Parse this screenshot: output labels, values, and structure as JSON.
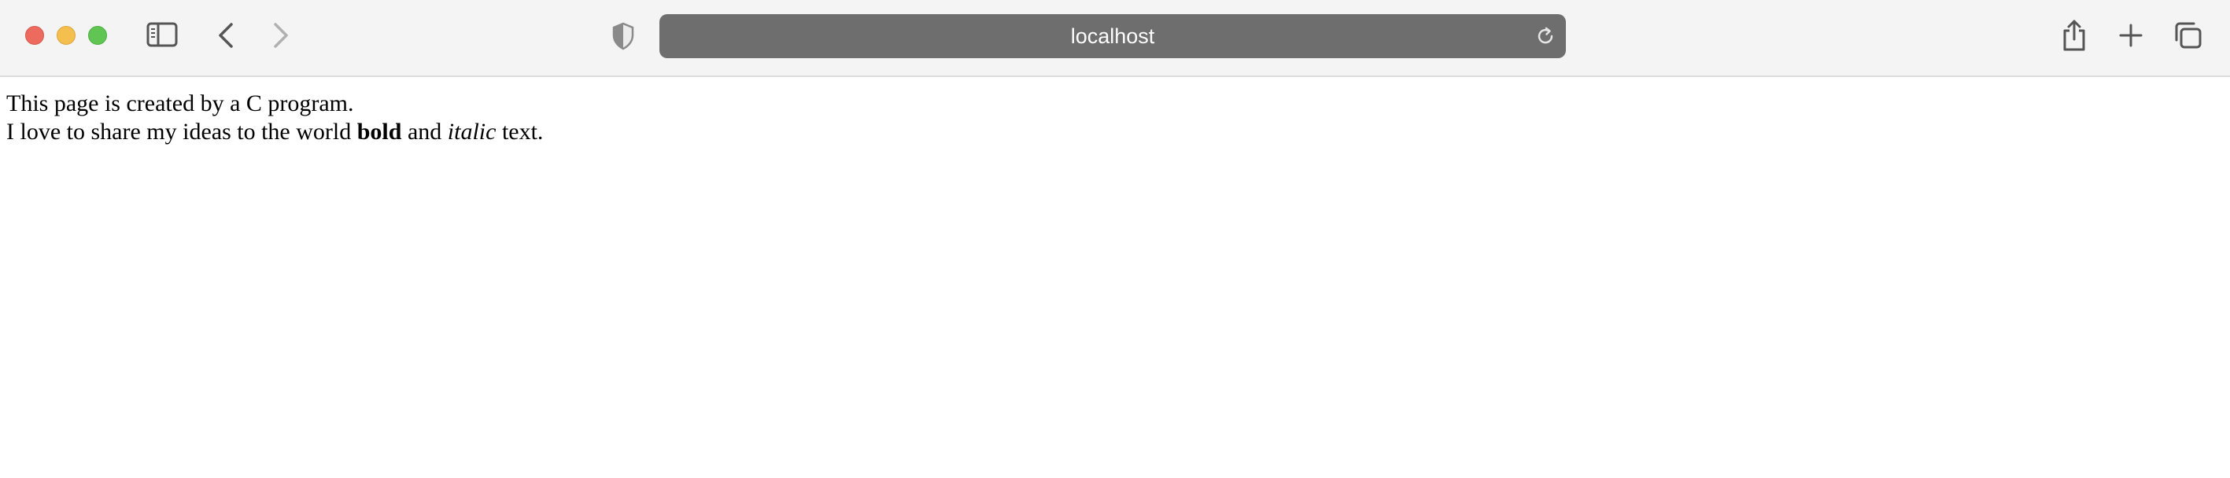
{
  "browser": {
    "url": "localhost",
    "icons": {
      "sidebar": "sidebar-icon",
      "back": "chevron-left-icon",
      "forward": "chevron-right-icon",
      "privacy": "shield-icon",
      "reload": "reload-icon",
      "share": "share-icon",
      "new_tab": "plus-icon",
      "tab_overview": "tabs-overview-icon"
    },
    "colors": {
      "close": "#ed6a5e",
      "minimize": "#f5bf4f",
      "maximize": "#61c554",
      "address_bar": "#6e6e6e"
    }
  },
  "page": {
    "line1": "This page is created by a C program.",
    "line2_prefix": "I love to share my ideas to the world ",
    "line2_bold": "bold",
    "line2_middle": " and ",
    "line2_italic": "italic",
    "line2_suffix": " text."
  }
}
